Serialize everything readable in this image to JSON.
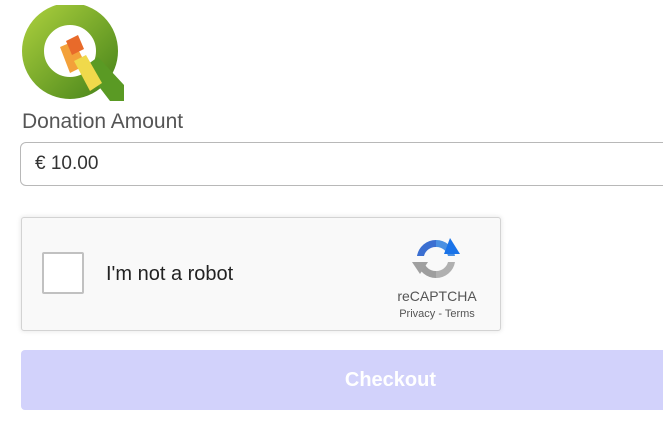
{
  "logo": {
    "icon": "qgis-logo-icon"
  },
  "donation": {
    "label": "Donation Amount",
    "amount_value": "€ 10.00"
  },
  "captcha": {
    "checkbox_label": "I'm not a robot",
    "brand": "reCAPTCHA",
    "privacy_link": "Privacy",
    "separator": " - ",
    "terms_link": "Terms",
    "checked": false,
    "icon": "recaptcha-logo-icon"
  },
  "checkout": {
    "label": "Checkout",
    "background_color": "#d2d2fb",
    "disabled": true
  }
}
